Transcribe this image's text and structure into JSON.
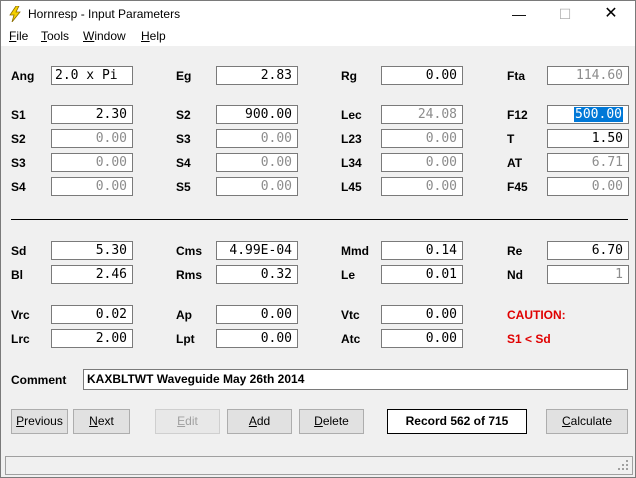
{
  "window": {
    "title": "Hornresp - Input Parameters",
    "minimize": "—",
    "maximize": "☐",
    "close": "✕"
  },
  "menu": [
    {
      "key": "F",
      "rest": "ile"
    },
    {
      "key": "T",
      "rest": "ools"
    },
    {
      "key": "W",
      "rest": "indow"
    },
    {
      "key": "H",
      "rest": "elp"
    }
  ],
  "params": {
    "ang": {
      "label": "Ang",
      "value": "2.0 x Pi"
    },
    "eg": {
      "label": "Eg",
      "value": "2.83"
    },
    "rg": {
      "label": "Rg",
      "value": "0.00"
    },
    "fta": {
      "label": "Fta",
      "value": "114.60"
    },
    "s1a": {
      "label": "S1",
      "value": "2.30"
    },
    "s2a": {
      "label": "S2",
      "value": "900.00"
    },
    "lec": {
      "label": "Lec",
      "value": "24.08"
    },
    "f12": {
      "label": "F12",
      "value": "500.00"
    },
    "s2b": {
      "label": "S2",
      "value": "0.00"
    },
    "s3a": {
      "label": "S3",
      "value": "0.00"
    },
    "l23": {
      "label": "L23",
      "value": "0.00"
    },
    "t": {
      "label": "T",
      "value": "1.50"
    },
    "s3b": {
      "label": "S3",
      "value": "0.00"
    },
    "s4a": {
      "label": "S4",
      "value": "0.00"
    },
    "l34": {
      "label": "L34",
      "value": "0.00"
    },
    "at": {
      "label": "AT",
      "value": "6.71"
    },
    "s4b": {
      "label": "S4",
      "value": "0.00"
    },
    "s5": {
      "label": "S5",
      "value": "0.00"
    },
    "l45": {
      "label": "L45",
      "value": "0.00"
    },
    "f45": {
      "label": "F45",
      "value": "0.00"
    },
    "sd": {
      "label": "Sd",
      "value": "5.30"
    },
    "cms": {
      "label": "Cms",
      "value": "4.99E-04"
    },
    "mmd": {
      "label": "Mmd",
      "value": "0.14"
    },
    "re": {
      "label": "Re",
      "value": "6.70"
    },
    "bl": {
      "label": "Bl",
      "value": "2.46"
    },
    "rms": {
      "label": "Rms",
      "value": "0.32"
    },
    "le": {
      "label": "Le",
      "value": "0.01"
    },
    "nd": {
      "label": "Nd",
      "value": "1"
    },
    "vrc": {
      "label": "Vrc",
      "value": "0.02"
    },
    "ap": {
      "label": "Ap",
      "value": "0.00"
    },
    "vtc": {
      "label": "Vtc",
      "value": "0.00"
    },
    "lrc": {
      "label": "Lrc",
      "value": "2.00"
    },
    "lpt": {
      "label": "Lpt",
      "value": "0.00"
    },
    "atc": {
      "label": "Atc",
      "value": "0.00"
    }
  },
  "caution": {
    "title": "CAUTION:",
    "message": "S1 < Sd"
  },
  "comment": {
    "label": "Comment",
    "value": "KAXBLTWT Waveguide May 26th 2014"
  },
  "buttons": {
    "previous": {
      "key": "P",
      "rest": "revious"
    },
    "next": {
      "key": "N",
      "rest": "ext"
    },
    "edit": {
      "key": "E",
      "rest": "dit"
    },
    "add": {
      "key": "A",
      "rest": "dd"
    },
    "delete": {
      "key": "D",
      "rest": "elete"
    },
    "calculate": {
      "key": "C",
      "rest": "alculate"
    }
  },
  "record": "Record 562 of 715",
  "colors": {
    "caution": "#e00000",
    "selection": "#0078d7"
  }
}
